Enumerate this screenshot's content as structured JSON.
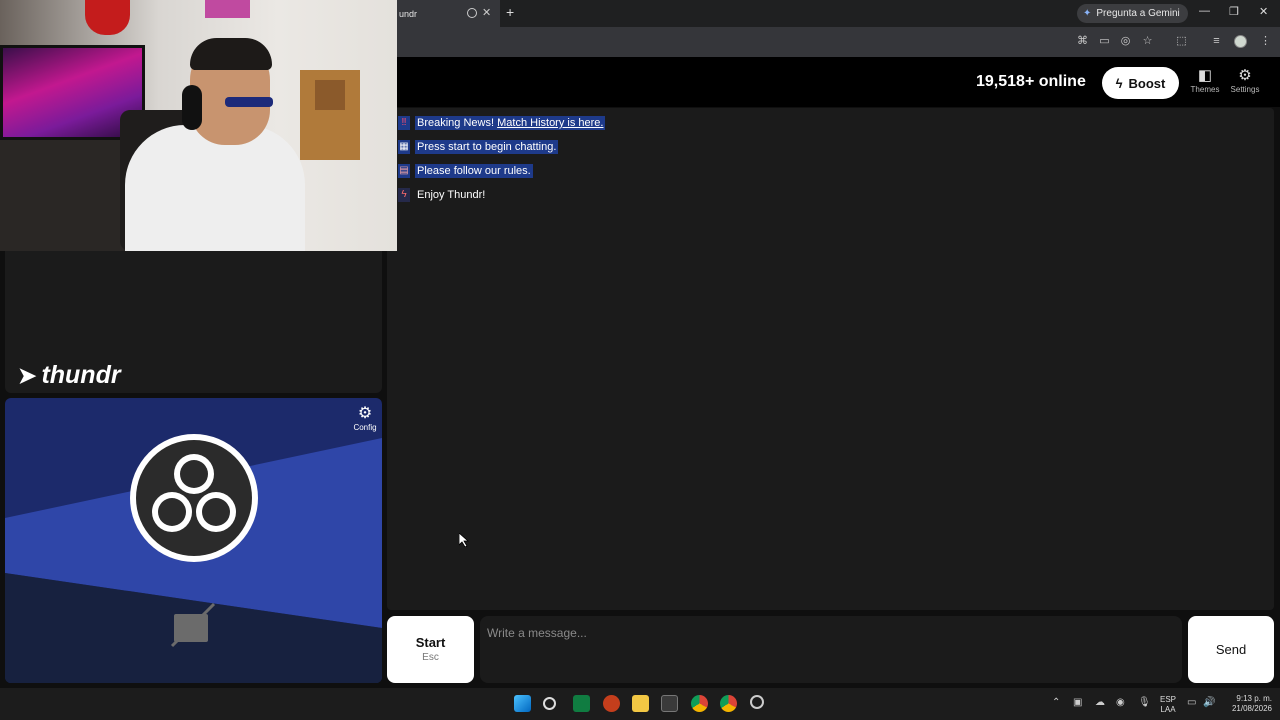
{
  "browser": {
    "tab_title": "undr",
    "tab_close": "✕",
    "new_tab": "+",
    "gemini_label": "Pregunta a Gemini",
    "window_controls": [
      "—",
      "❐",
      "✕"
    ]
  },
  "header": {
    "online_count": "19,518+ online",
    "boost_label": "Boost",
    "themes_label": "Themes",
    "settings_label": "Settings"
  },
  "chat": {
    "messages": [
      {
        "icon": "double-exclamation-icon",
        "prefix": "Breaking News!",
        "link": "Match History is here.",
        "highlighted": true
      },
      {
        "icon": "checkered-flag-icon",
        "text": "Press start to begin chatting.",
        "highlighted": true
      },
      {
        "icon": "scroll-icon",
        "text": "Please follow our rules.",
        "highlighted": true
      },
      {
        "icon": "lightning-icon",
        "text": "Enjoy Thundr!",
        "highlighted": false
      }
    ]
  },
  "left": {
    "brand": "thundr",
    "config_label": "Config"
  },
  "composer": {
    "start_label": "Start",
    "start_hint": "Esc",
    "placeholder": "Write a message...",
    "send_label": "Send"
  },
  "taskbar": {
    "lang_top": "ESP",
    "lang_bottom": "LAA",
    "time": "9:13 p. m.",
    "date": "21/08/2026"
  },
  "colors": {
    "accent_highlight": "#1e3a8a",
    "panel_bg": "#1b1b1b",
    "obs_blue": "#1c2a6b"
  }
}
